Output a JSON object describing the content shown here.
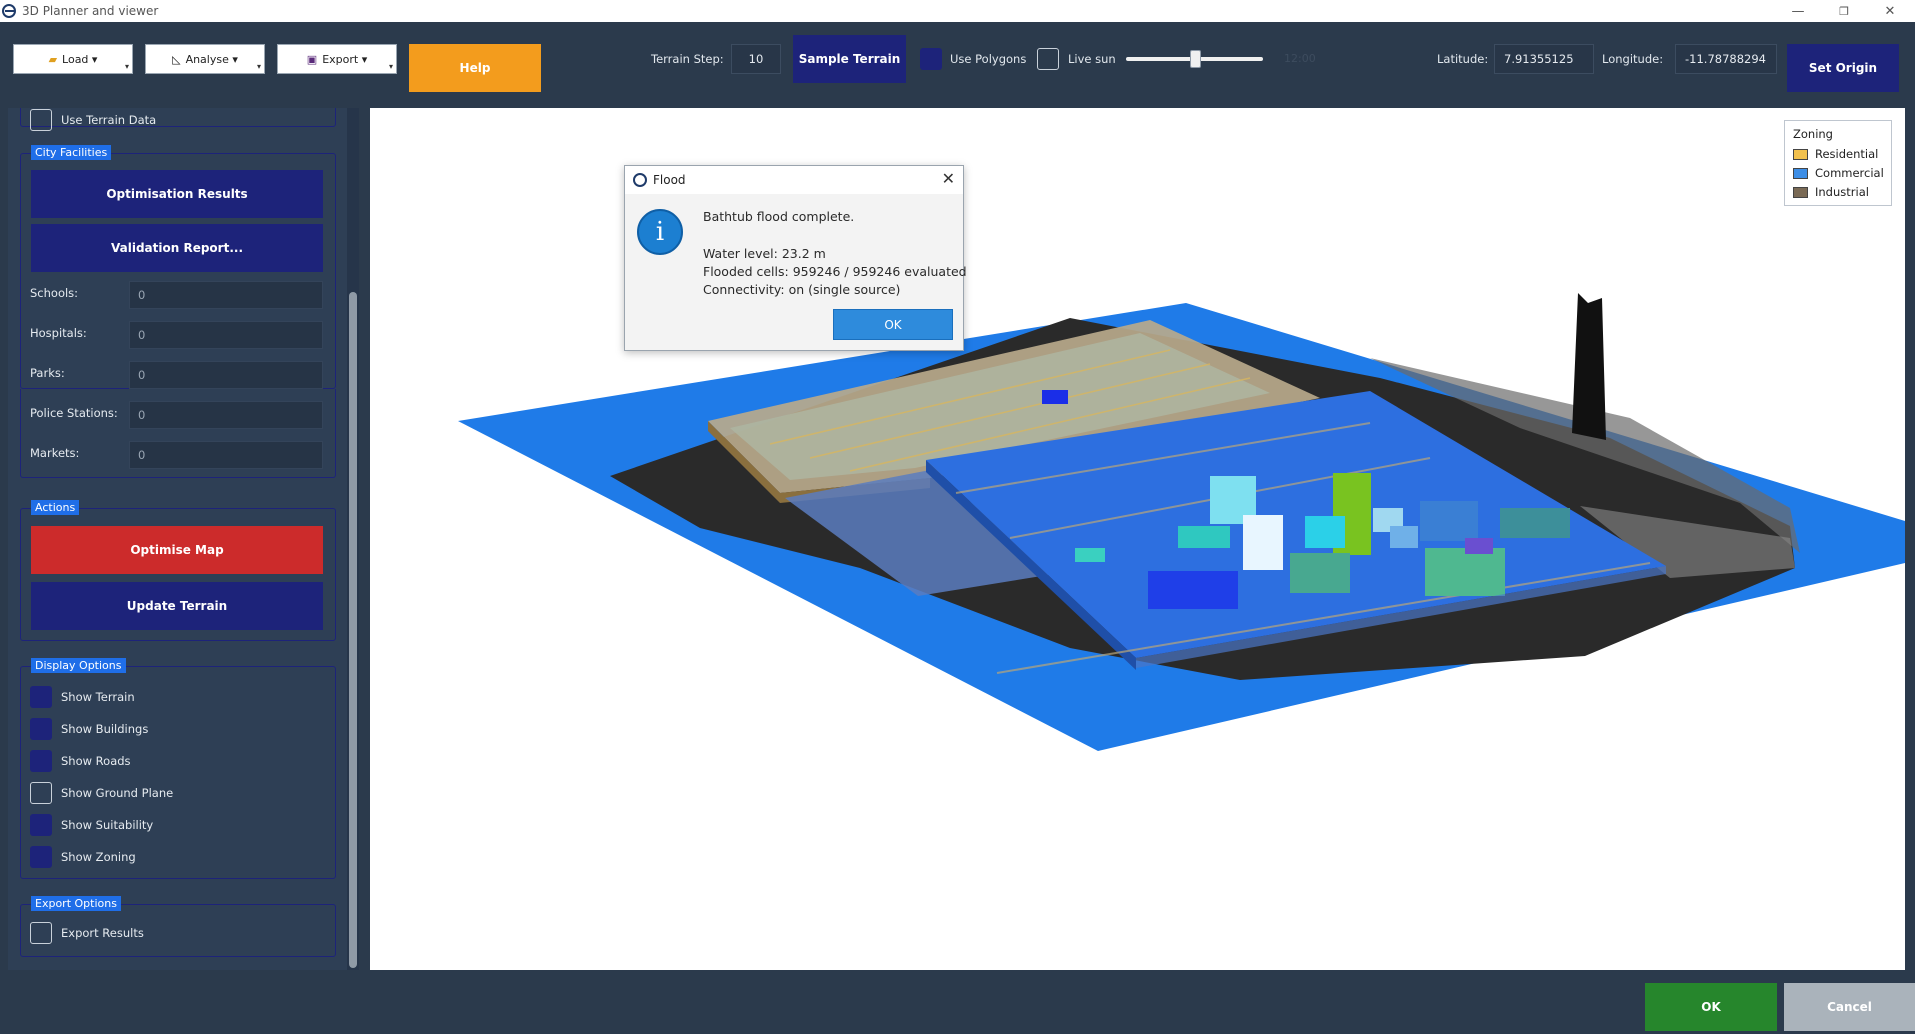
{
  "window": {
    "title": "3D Planner and viewer",
    "minimize": "—",
    "maximize": "❐",
    "close": "✕"
  },
  "toolbar": {
    "load_label": "Load ▾",
    "analyse_label": "Analyse ▾",
    "export_label": "Export ▾",
    "help_label": "Help",
    "terrain_step_label": "Terrain Step:",
    "terrain_step_value": "10",
    "sample_terrain_label": "Sample Terrain",
    "use_polygons_label": "Use Polygons",
    "live_sun_label": "Live sun",
    "sun_time": "12:00",
    "sun_slider_value": 0.5,
    "latitude_label": "Latitude:",
    "latitude_value": "7.91355125",
    "longitude_label": "Longitude:",
    "longitude_value": "-11.78788294",
    "set_origin_label": "Set Origin"
  },
  "sidebar": {
    "use_terrain_data_label": "Use Terrain Data",
    "city_facilities": {
      "title": "City Facilities",
      "optimisation_results_label": "Optimisation Results",
      "validation_report_label": "Validation Report...",
      "fields": [
        {
          "label": "Schools:",
          "value": "0"
        },
        {
          "label": "Hospitals:",
          "value": "0"
        },
        {
          "label": "Parks:",
          "value": "0"
        },
        {
          "label": "Police Stations:",
          "value": "0"
        },
        {
          "label": "Markets:",
          "value": "0"
        }
      ]
    },
    "actions": {
      "title": "Actions",
      "optimise_map_label": "Optimise Map",
      "update_terrain_label": "Update Terrain"
    },
    "display_options": {
      "title": "Display Options",
      "items": [
        {
          "label": "Show Terrain",
          "checked": true
        },
        {
          "label": "Show Buildings",
          "checked": true
        },
        {
          "label": "Show Roads",
          "checked": true
        },
        {
          "label": "Show Ground Plane",
          "checked": false
        },
        {
          "label": "Show Suitability",
          "checked": true
        },
        {
          "label": "Show Zoning",
          "checked": true
        }
      ]
    },
    "export_options": {
      "title": "Export Options",
      "export_results_label": "Export Results"
    }
  },
  "legend": {
    "title": "Zoning",
    "items": [
      {
        "label": "Residential",
        "color": "#f2c14e"
      },
      {
        "label": "Commercial",
        "color": "#3d8ee6"
      },
      {
        "label": "Industrial",
        "color": "#7a6a55"
      }
    ]
  },
  "dialog": {
    "title": "Flood",
    "message": "Bathtub flood complete.",
    "water_level": "Water level:   23.2 m",
    "flooded_cells": "Flooded cells: 959246 / 959246 evaluated",
    "connectivity": "Connectivity:  on (single source)",
    "ok_label": "OK"
  },
  "footer": {
    "ok_label": "OK",
    "cancel_label": "Cancel"
  },
  "colors": {
    "navy": "#1d237a",
    "help_orange": "#f39c1d",
    "danger_red": "#cc2b2b",
    "ok_green": "#26862c",
    "water_blue": "#1f7be8"
  }
}
